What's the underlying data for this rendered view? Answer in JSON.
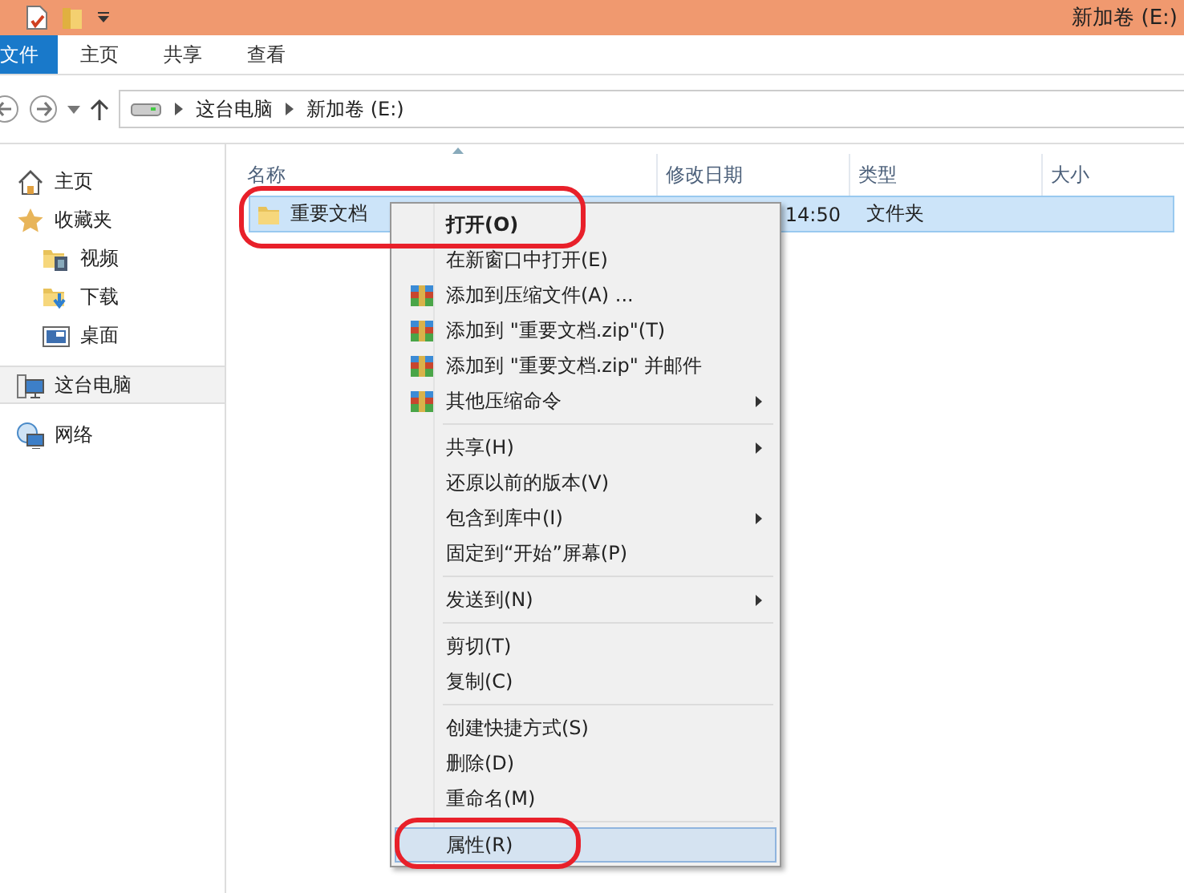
{
  "window": {
    "title": "新加卷 (E:)"
  },
  "ribbon_tabs": [
    {
      "label": "文件",
      "selected": true
    },
    {
      "label": "主页",
      "selected": false
    },
    {
      "label": "共享",
      "selected": false
    },
    {
      "label": "查看",
      "selected": false
    }
  ],
  "address": {
    "path": [
      "这台电脑",
      "新加卷 (E:)"
    ]
  },
  "sidebar": {
    "items": [
      {
        "label": "主页",
        "kind": "home",
        "selected": false
      },
      {
        "label": "收藏夹",
        "kind": "star",
        "selected": false,
        "children": [
          {
            "label": "视频",
            "kind": "video",
            "selected": false
          },
          {
            "label": "下载",
            "kind": "download",
            "selected": false
          },
          {
            "label": "桌面",
            "kind": "desktop",
            "selected": false
          }
        ]
      },
      {
        "label": "这台电脑",
        "kind": "pc",
        "selected": true
      },
      {
        "label": "网络",
        "kind": "network",
        "selected": false
      }
    ]
  },
  "table": {
    "columns": [
      "名称",
      "修改日期",
      "类型",
      "大小"
    ],
    "rows": [
      {
        "name": "重要文档",
        "modified": "14:50",
        "type": "文件夹",
        "selected": true,
        "circled": true
      }
    ]
  },
  "context_menu": {
    "items": [
      {
        "kind": "plain",
        "label": "打开(O)",
        "bold": true,
        "submenu": false,
        "highlighted": false,
        "circled": true
      },
      {
        "kind": "plain",
        "label": "在新窗口中打开(E)",
        "bold": false,
        "submenu": false,
        "highlighted": false,
        "circled": false
      },
      {
        "kind": "archive",
        "label": "添加到压缩文件(A) ...",
        "bold": false,
        "submenu": false,
        "highlighted": false,
        "circled": false
      },
      {
        "kind": "archive",
        "label": "添加到 \"重要文档.zip\"(T)",
        "bold": false,
        "submenu": false,
        "highlighted": false,
        "circled": false
      },
      {
        "kind": "archive",
        "label": "添加到 \"重要文档.zip\" 并邮件",
        "bold": false,
        "submenu": false,
        "highlighted": false,
        "circled": false
      },
      {
        "kind": "archive",
        "label": "其他压缩命令",
        "bold": false,
        "submenu": true,
        "highlighted": false,
        "circled": false
      },
      {
        "kind": "separator"
      },
      {
        "kind": "plain",
        "label": "共享(H)",
        "bold": false,
        "submenu": true,
        "highlighted": false,
        "circled": false
      },
      {
        "kind": "plain",
        "label": "还原以前的版本(V)",
        "bold": false,
        "submenu": false,
        "highlighted": false,
        "circled": false
      },
      {
        "kind": "plain",
        "label": "包含到库中(I)",
        "bold": false,
        "submenu": true,
        "highlighted": false,
        "circled": false
      },
      {
        "kind": "plain",
        "label": "固定到“开始”屏幕(P)",
        "bold": false,
        "submenu": false,
        "highlighted": false,
        "circled": false
      },
      {
        "kind": "separator"
      },
      {
        "kind": "plain",
        "label": "发送到(N)",
        "bold": false,
        "submenu": true,
        "highlighted": false,
        "circled": false
      },
      {
        "kind": "separator"
      },
      {
        "kind": "plain",
        "label": "剪切(T)",
        "bold": false,
        "submenu": false,
        "highlighted": false,
        "circled": false
      },
      {
        "kind": "plain",
        "label": "复制(C)",
        "bold": false,
        "submenu": false,
        "highlighted": false,
        "circled": false
      },
      {
        "kind": "separator"
      },
      {
        "kind": "plain",
        "label": "创建快捷方式(S)",
        "bold": false,
        "submenu": false,
        "highlighted": false,
        "circled": false
      },
      {
        "kind": "plain",
        "label": "删除(D)",
        "bold": false,
        "submenu": false,
        "highlighted": false,
        "circled": false
      },
      {
        "kind": "plain",
        "label": "重命名(M)",
        "bold": false,
        "submenu": false,
        "highlighted": false,
        "circled": false
      },
      {
        "kind": "separator"
      },
      {
        "kind": "plain",
        "label": "属性(R)",
        "bold": false,
        "submenu": false,
        "highlighted": true,
        "circled": true
      }
    ]
  }
}
